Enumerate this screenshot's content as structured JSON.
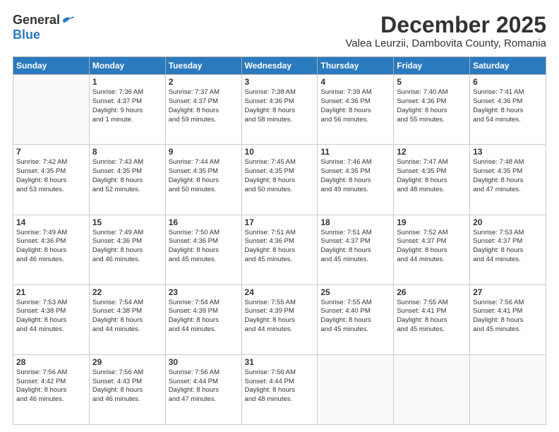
{
  "logo": {
    "general": "General",
    "blue": "Blue"
  },
  "title": "December 2025",
  "subtitle": "Valea Leurzii, Dambovita County, Romania",
  "weekdays": [
    "Sunday",
    "Monday",
    "Tuesday",
    "Wednesday",
    "Thursday",
    "Friday",
    "Saturday"
  ],
  "weeks": [
    [
      {
        "day": "",
        "info": ""
      },
      {
        "day": "1",
        "info": "Sunrise: 7:36 AM\nSunset: 4:37 PM\nDaylight: 9 hours\nand 1 minute."
      },
      {
        "day": "2",
        "info": "Sunrise: 7:37 AM\nSunset: 4:37 PM\nDaylight: 8 hours\nand 59 minutes."
      },
      {
        "day": "3",
        "info": "Sunrise: 7:38 AM\nSunset: 4:36 PM\nDaylight: 8 hours\nand 58 minutes."
      },
      {
        "day": "4",
        "info": "Sunrise: 7:39 AM\nSunset: 4:36 PM\nDaylight: 8 hours\nand 56 minutes."
      },
      {
        "day": "5",
        "info": "Sunrise: 7:40 AM\nSunset: 4:36 PM\nDaylight: 8 hours\nand 55 minutes."
      },
      {
        "day": "6",
        "info": "Sunrise: 7:41 AM\nSunset: 4:36 PM\nDaylight: 8 hours\nand 54 minutes."
      }
    ],
    [
      {
        "day": "7",
        "info": "Sunrise: 7:42 AM\nSunset: 4:35 PM\nDaylight: 8 hours\nand 53 minutes."
      },
      {
        "day": "8",
        "info": "Sunrise: 7:43 AM\nSunset: 4:35 PM\nDaylight: 8 hours\nand 52 minutes."
      },
      {
        "day": "9",
        "info": "Sunrise: 7:44 AM\nSunset: 4:35 PM\nDaylight: 8 hours\nand 50 minutes."
      },
      {
        "day": "10",
        "info": "Sunrise: 7:45 AM\nSunset: 4:35 PM\nDaylight: 8 hours\nand 50 minutes."
      },
      {
        "day": "11",
        "info": "Sunrise: 7:46 AM\nSunset: 4:35 PM\nDaylight: 8 hours\nand 49 minutes."
      },
      {
        "day": "12",
        "info": "Sunrise: 7:47 AM\nSunset: 4:35 PM\nDaylight: 8 hours\nand 48 minutes."
      },
      {
        "day": "13",
        "info": "Sunrise: 7:48 AM\nSunset: 4:35 PM\nDaylight: 8 hours\nand 47 minutes."
      }
    ],
    [
      {
        "day": "14",
        "info": "Sunrise: 7:49 AM\nSunset: 4:36 PM\nDaylight: 8 hours\nand 46 minutes."
      },
      {
        "day": "15",
        "info": "Sunrise: 7:49 AM\nSunset: 4:36 PM\nDaylight: 8 hours\nand 46 minutes."
      },
      {
        "day": "16",
        "info": "Sunrise: 7:50 AM\nSunset: 4:36 PM\nDaylight: 8 hours\nand 45 minutes."
      },
      {
        "day": "17",
        "info": "Sunrise: 7:51 AM\nSunset: 4:36 PM\nDaylight: 8 hours\nand 45 minutes."
      },
      {
        "day": "18",
        "info": "Sunrise: 7:51 AM\nSunset: 4:37 PM\nDaylight: 8 hours\nand 45 minutes."
      },
      {
        "day": "19",
        "info": "Sunrise: 7:52 AM\nSunset: 4:37 PM\nDaylight: 8 hours\nand 44 minutes."
      },
      {
        "day": "20",
        "info": "Sunrise: 7:53 AM\nSunset: 4:37 PM\nDaylight: 8 hours\nand 44 minutes."
      }
    ],
    [
      {
        "day": "21",
        "info": "Sunrise: 7:53 AM\nSunset: 4:38 PM\nDaylight: 8 hours\nand 44 minutes."
      },
      {
        "day": "22",
        "info": "Sunrise: 7:54 AM\nSunset: 4:38 PM\nDaylight: 8 hours\nand 44 minutes."
      },
      {
        "day": "23",
        "info": "Sunrise: 7:54 AM\nSunset: 4:39 PM\nDaylight: 8 hours\nand 44 minutes."
      },
      {
        "day": "24",
        "info": "Sunrise: 7:55 AM\nSunset: 4:39 PM\nDaylight: 8 hours\nand 44 minutes."
      },
      {
        "day": "25",
        "info": "Sunrise: 7:55 AM\nSunset: 4:40 PM\nDaylight: 8 hours\nand 45 minutes."
      },
      {
        "day": "26",
        "info": "Sunrise: 7:55 AM\nSunset: 4:41 PM\nDaylight: 8 hours\nand 45 minutes."
      },
      {
        "day": "27",
        "info": "Sunrise: 7:56 AM\nSunset: 4:41 PM\nDaylight: 8 hours\nand 45 minutes."
      }
    ],
    [
      {
        "day": "28",
        "info": "Sunrise: 7:56 AM\nSunset: 4:42 PM\nDaylight: 8 hours\nand 46 minutes."
      },
      {
        "day": "29",
        "info": "Sunrise: 7:56 AM\nSunset: 4:43 PM\nDaylight: 8 hours\nand 46 minutes."
      },
      {
        "day": "30",
        "info": "Sunrise: 7:56 AM\nSunset: 4:44 PM\nDaylight: 8 hours\nand 47 minutes."
      },
      {
        "day": "31",
        "info": "Sunrise: 7:56 AM\nSunset: 4:44 PM\nDaylight: 8 hours\nand 48 minutes."
      },
      {
        "day": "",
        "info": ""
      },
      {
        "day": "",
        "info": ""
      },
      {
        "day": "",
        "info": ""
      }
    ]
  ]
}
